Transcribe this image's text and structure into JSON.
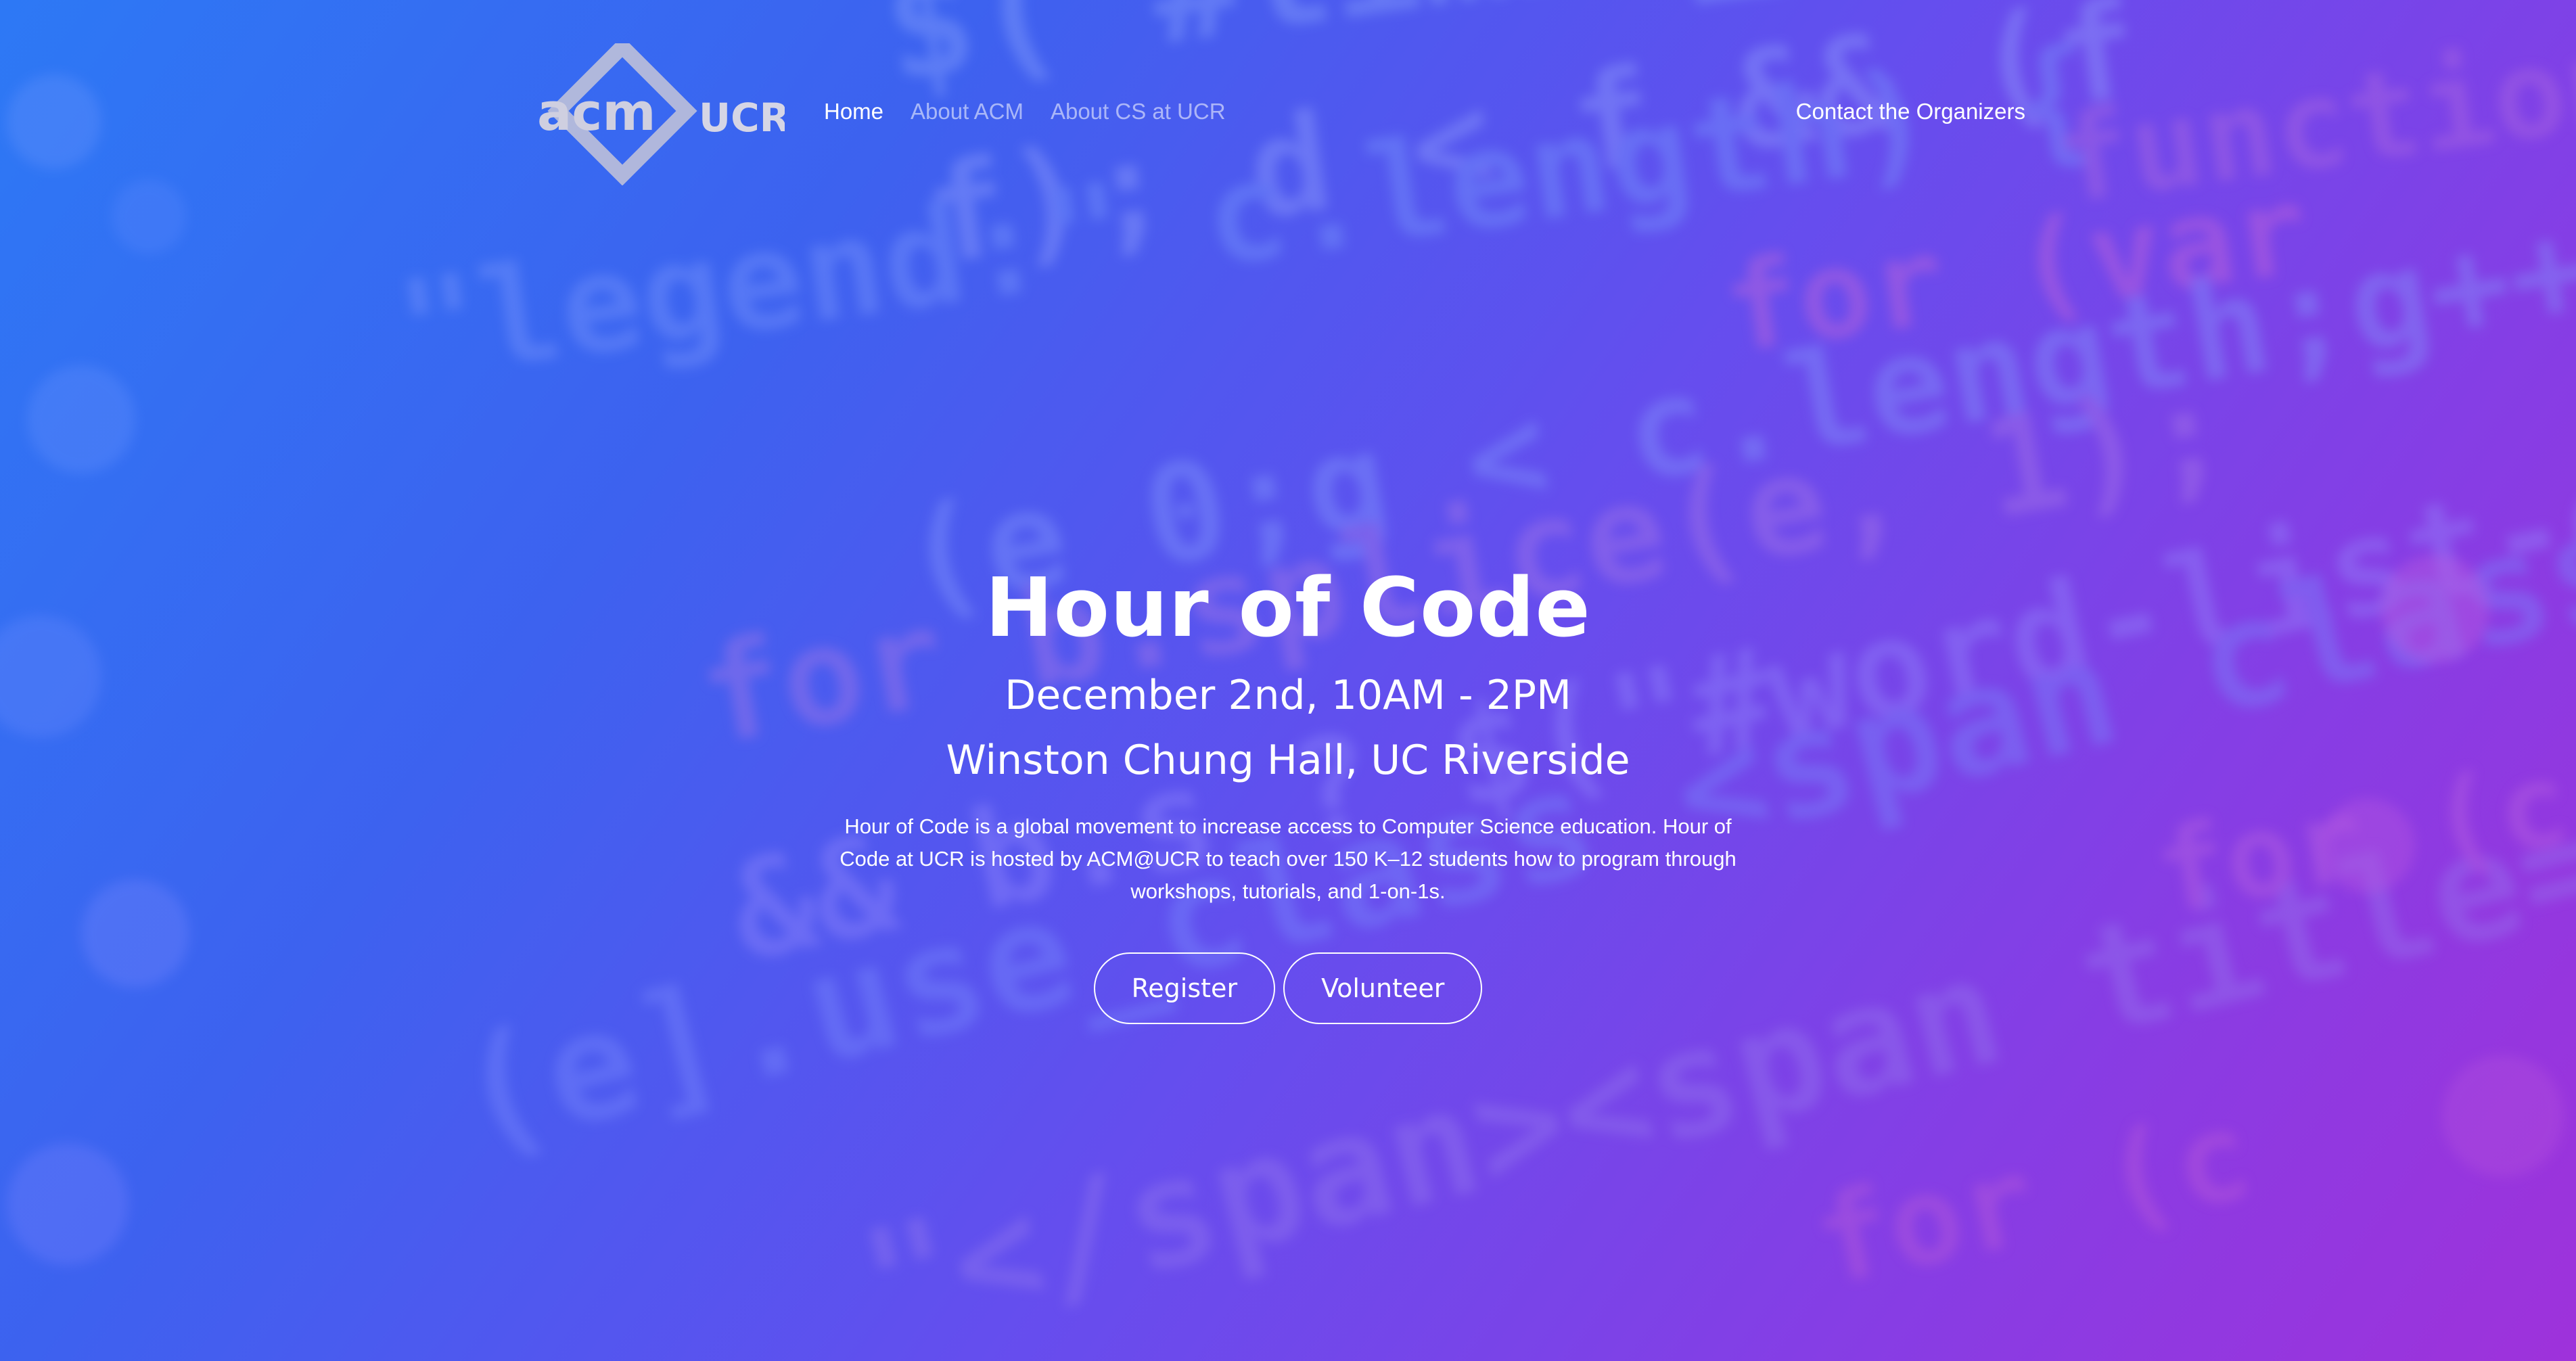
{
  "nav": {
    "logo_text_left": "acm",
    "logo_text_right": "UCR",
    "links": [
      {
        "label": "Home",
        "active": true
      },
      {
        "label": "About ACM",
        "active": false
      },
      {
        "label": "About CS at UCR",
        "active": false
      }
    ],
    "contact_label": "Contact the Organizers"
  },
  "hero": {
    "title": "Hour of Code",
    "date": "December 2nd, 10AM - 2PM",
    "location": "Winston Chung Hall, UC Riverside",
    "description": "Hour of Code is a global movement to increase access to Computer Science education. Hour of Code at UCR is hosted by ACM@UCR to teach over 150 K–12 students how to program through workshops, tutorials, and 1-on-1s.",
    "buttons": {
      "register": "Register",
      "volunteer": "Volunteer"
    }
  },
  "colors": {
    "gradient_start": "#2f7df7",
    "gradient_mid": "#6a4ef0",
    "gradient_end": "#a232da",
    "text": "#ffffff"
  }
}
